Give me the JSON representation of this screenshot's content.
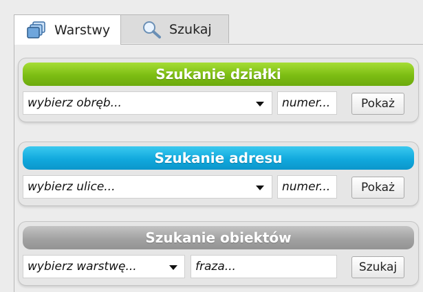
{
  "tabs": [
    {
      "label": "Warstwy",
      "icon": "layers-icon",
      "active": true
    },
    {
      "label": "Szukaj",
      "icon": "search-icon",
      "active": false
    }
  ],
  "parcel_search": {
    "title": "Szukanie działki",
    "select_placeholder": "wybierz obręb...",
    "number_placeholder": "numer...",
    "button_label": "Pokaż",
    "header_color": "#7cbd13"
  },
  "address_search": {
    "title": "Szukanie adresu",
    "select_placeholder": "wybierz ulice...",
    "number_placeholder": "numer...",
    "button_label": "Pokaż",
    "header_color": "#11a9dd"
  },
  "object_search": {
    "title": "Szukanie obiektów",
    "select_placeholder": "wybierz warstwę...",
    "phrase_placeholder": "fraza...",
    "button_label": "Szukaj",
    "header_color": "#a2a2a2"
  }
}
